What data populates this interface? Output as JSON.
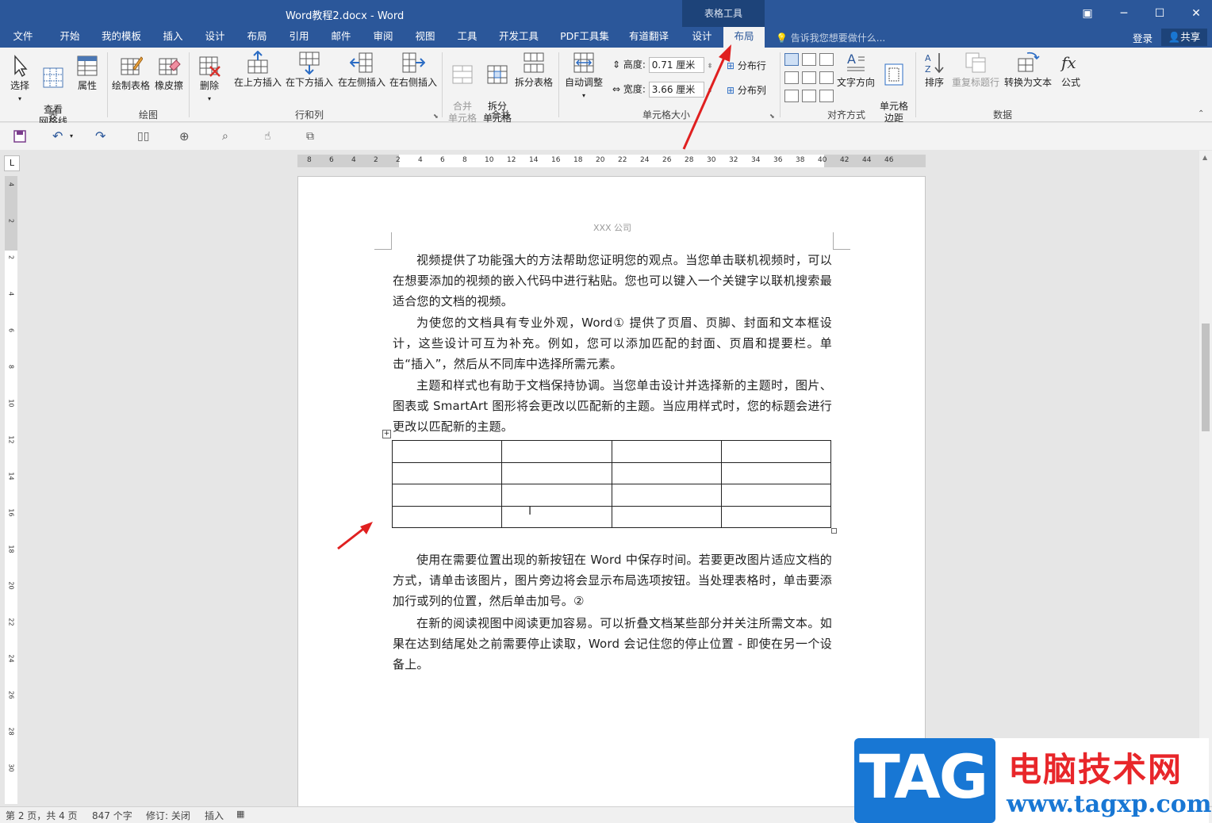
{
  "titlebar": {
    "doc_title": "Word教程2.docx - Word",
    "context_tools": "表格工具"
  },
  "tabs": [
    {
      "label": "文件"
    },
    {
      "label": "开始"
    },
    {
      "label": "我的模板"
    },
    {
      "label": "插入"
    },
    {
      "label": "设计"
    },
    {
      "label": "布局"
    },
    {
      "label": "引用"
    },
    {
      "label": "邮件"
    },
    {
      "label": "审阅"
    },
    {
      "label": "视图"
    },
    {
      "label": "工具"
    },
    {
      "label": "开发工具"
    },
    {
      "label": "PDF工具集"
    },
    {
      "label": "有道翻译"
    },
    {
      "label": "设计"
    },
    {
      "label": "布局"
    }
  ],
  "tell_me": "告诉我您想要做什么...",
  "login": "登录",
  "share": "共享",
  "ribbon": {
    "table_group": {
      "label": "表",
      "select": "选择",
      "gridlines": "查看\n网格线",
      "properties": "属性"
    },
    "draw_group": {
      "label": "绘图",
      "draw_table": "绘制表格",
      "eraser": "橡皮擦"
    },
    "rowcol_group": {
      "label": "行和列",
      "delete": "删除",
      "insert_above": "在上方插入",
      "insert_below": "在下方插入",
      "insert_left": "在左侧插入",
      "insert_right": "在右侧插入"
    },
    "merge_group": {
      "label": "合并",
      "merge_cells": "合并\n单元格",
      "split_cells": "拆分\n单元格",
      "split_table": "拆分表格"
    },
    "cellsize_group": {
      "label": "单元格大小",
      "autofit": "自动调整",
      "height_label": "高度:",
      "height_value": "0.71 厘米",
      "width_label": "宽度:",
      "width_value": "3.66 厘米",
      "dist_rows": "分布行",
      "dist_cols": "分布列"
    },
    "align_group": {
      "label": "对齐方式",
      "text_direction": "文字方向",
      "cell_margins": "单元格\n边距"
    },
    "data_group": {
      "label": "数据",
      "sort": "排序",
      "repeat_header": "重复标题行",
      "convert_text": "转换为文本",
      "formula": "公式"
    }
  },
  "document": {
    "header": "XXX 公司",
    "paragraphs": [
      "视频提供了功能强大的方法帮助您证明您的观点。当您单击联机视频时，可以在想要添加的视频的嵌入代码中进行粘贴。您也可以键入一个关键字以联机搜索最适合您的文档的视频。",
      "为使您的文档具有专业外观，Word① 提供了页眉、页脚、封面和文本框设计，这些设计可互为补充。例如，您可以添加匹配的封面、页眉和提要栏。单击“插入”，然后从不同库中选择所需元素。",
      "主题和样式也有助于文档保持协调。当您单击设计并选择新的主题时，图片、图表或 SmartArt 图形将会更改以匹配新的主题。当应用样式时，您的标题会进行更改以匹配新的主题。",
      "使用在需要位置出现的新按钮在 Word 中保存时间。若要更改图片适应文档的方式，请单击该图片，图片旁边将会显示布局选项按钮。当处理表格时，单击要添加行或列的位置，然后单击加号。②",
      "在新的阅读视图中阅读更加容易。可以折叠文档某些部分并关注所需文本。如果在达到结尾处之前需要停止读取，Word 会记住您的停止位置 - 即使在另一个设备上。"
    ],
    "table": {
      "rows": 4,
      "cols": 4
    }
  },
  "ruler": {
    "h_ticks": [
      "8",
      "6",
      "4",
      "2",
      "2",
      "4",
      "6",
      "8",
      "10",
      "12",
      "14",
      "16",
      "18",
      "20",
      "22",
      "24",
      "26",
      "28",
      "30",
      "32",
      "34",
      "36",
      "38",
      "40",
      "42",
      "44",
      "46"
    ],
    "v_ticks": [
      "4",
      "2",
      "2",
      "4",
      "6",
      "8",
      "10",
      "12",
      "14",
      "16",
      "18",
      "20",
      "22",
      "24",
      "26",
      "28",
      "30"
    ]
  },
  "status": {
    "page": "第 2 页，共 4 页",
    "words": "847 个字",
    "track": "修订: 关闭",
    "insert": "插入"
  },
  "watermark": {
    "tag": "TAG",
    "cn": "电脑技术网",
    "url": "www.tagxp.com"
  },
  "colors": {
    "word_blue": "#2b579a",
    "arrow_red": "#e02020",
    "tag_blue": "#1877d4"
  }
}
